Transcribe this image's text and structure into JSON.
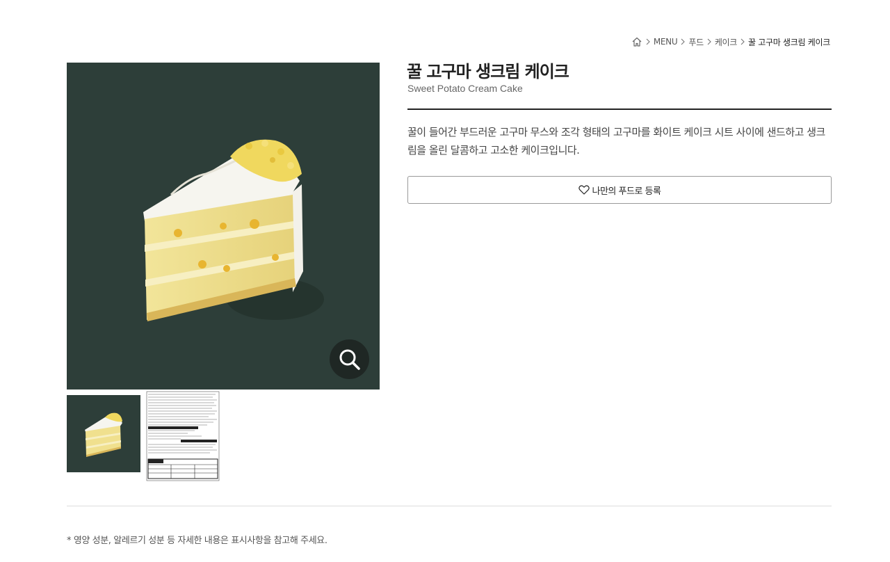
{
  "breadcrumb": {
    "home_icon": "home-icon",
    "items": [
      "MENU",
      "푸드",
      "케이크",
      "꿀 고구마 생크림 케이크"
    ]
  },
  "product": {
    "title_ko": "꿀 고구마 생크림 케이크",
    "title_en": "Sweet Potato Cream Cake",
    "description": "꿀이 들어간 부드러운 고구마 무스와 조각 형태의 고구마를 화이트 케이크 시트 사이에 샌드하고 생크림을 올린 달콤하고 고소한 케이크입니다.",
    "favorite_label": "나만의 푸드로 등록"
  },
  "gallery": {
    "zoom_icon": "magnifier-icon",
    "thumbnails": [
      "cake-photo",
      "nutrition-label"
    ]
  },
  "footer": {
    "note": "* 영양 성분, 알레르기 성분 등 자세한 내용은 표시사항을 참고해 주세요."
  },
  "colors": {
    "image_background": "#2d3e39",
    "zoom_button": "#1f2724",
    "rule": "#222222"
  }
}
